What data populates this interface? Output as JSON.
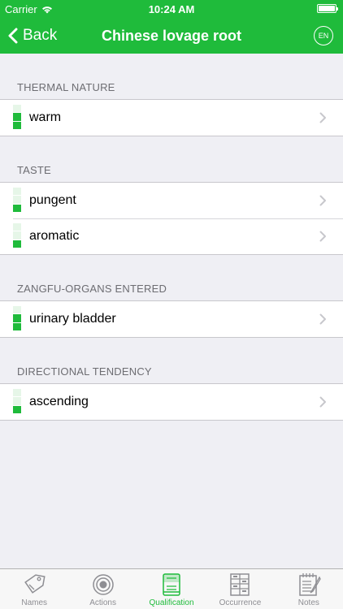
{
  "status": {
    "carrier": "Carrier",
    "time": "10:24 AM"
  },
  "nav": {
    "back_label": "Back",
    "title": "Chinese lovage root",
    "lang": "EN"
  },
  "sections": [
    {
      "header": "THERMAL NATURE",
      "rows": [
        {
          "label": "warm",
          "level": 2
        }
      ]
    },
    {
      "header": "TASTE",
      "rows": [
        {
          "label": "pungent",
          "level": 1
        },
        {
          "label": "aromatic",
          "level": 1
        }
      ]
    },
    {
      "header": "ZANGFU-ORGANS ENTERED",
      "rows": [
        {
          "label": "urinary bladder",
          "level": 2
        }
      ]
    },
    {
      "header": "DIRECTIONAL TENDENCY",
      "rows": [
        {
          "label": "ascending",
          "level": 1
        }
      ]
    }
  ],
  "tabs": [
    {
      "label": "Names",
      "icon": "tag-icon",
      "active": false
    },
    {
      "label": "Actions",
      "icon": "target-icon",
      "active": false
    },
    {
      "label": "Qualification",
      "icon": "book-icon",
      "active": true
    },
    {
      "label": "Occurrence",
      "icon": "cabinet-icon",
      "active": false
    },
    {
      "label": "Notes",
      "icon": "notepad-icon",
      "active": false
    }
  ],
  "colors": {
    "accent": "#1fbb3b",
    "level_on": "#1fbb3b",
    "level_off": "#e6f6e8"
  }
}
